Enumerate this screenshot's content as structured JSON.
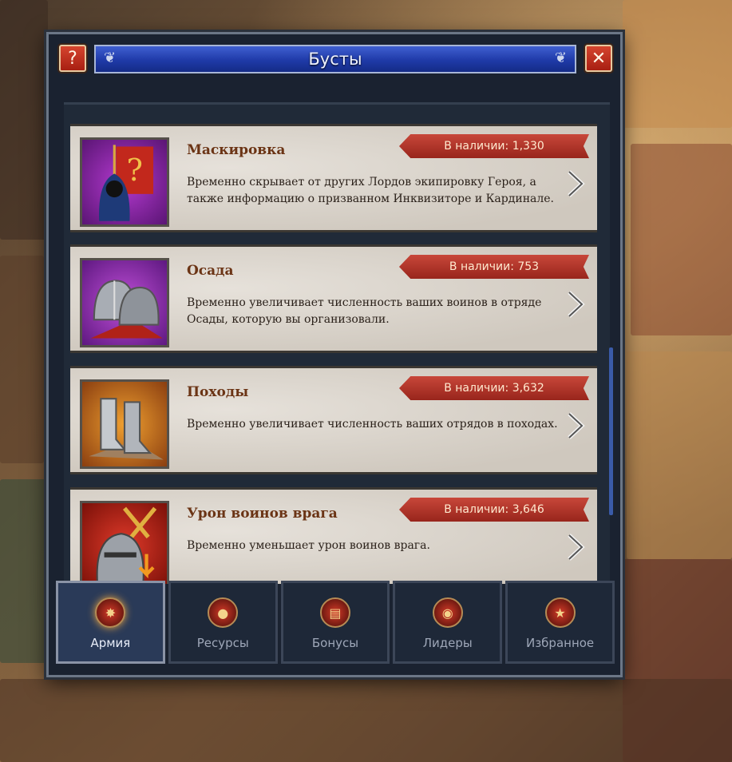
{
  "window": {
    "title": "Бусты"
  },
  "buttons": {
    "help_label": "?",
    "close_label": "✕"
  },
  "boosts": [
    {
      "name": "Маскировка",
      "available": "В наличии: 1,330",
      "description": "Временно скрывает от других Лордов экипировку Героя, а также информацию о призванном Инквизиторе и Кардинале.",
      "icon": "hooded-figure-banner-icon"
    },
    {
      "name": "Осада",
      "available": "В наличии: 753",
      "description": "Временно увеличивает численность ваших воинов в отряде Осады, которую вы организовали.",
      "icon": "helmets-icon"
    },
    {
      "name": "Походы",
      "available": "В наличии: 3,632",
      "description": "Временно увеличивает численность ваших отрядов в походах.",
      "icon": "boots-icon"
    },
    {
      "name": "Урон воинов врага",
      "available": "В наличии: 3,646",
      "description": "Временно уменьшает урон воинов врага.",
      "icon": "knight-helmet-icon"
    }
  ],
  "tabs": [
    {
      "label": "Армия",
      "icon": "army-icon",
      "active": true
    },
    {
      "label": "Ресурсы",
      "icon": "resources-icon",
      "active": false
    },
    {
      "label": "Бонусы",
      "icon": "bonuses-icon",
      "active": false
    },
    {
      "label": "Лидеры",
      "icon": "leaders-icon",
      "active": false
    },
    {
      "label": "Избранное",
      "icon": "favorites-icon",
      "active": false
    }
  ],
  "colors": {
    "title_bar": "#1f3aa8",
    "ribbon": "#b0342a",
    "card": "#d8d2ca",
    "item_name": "#6b3415"
  }
}
